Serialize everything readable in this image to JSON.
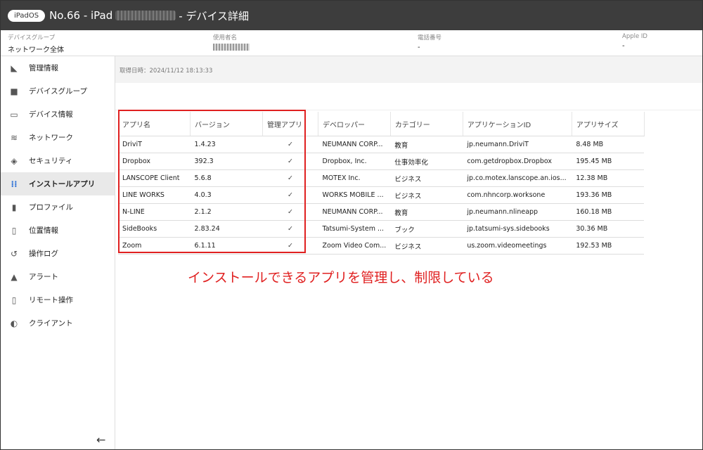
{
  "header": {
    "os_badge": "iPadOS",
    "title_prefix": "No.66 - iPad",
    "title_suffix": "- デバイス詳細"
  },
  "info": {
    "device_group_label": "デバイスグループ",
    "device_group_value": "ネットワーク全体",
    "user_label": "使用者名",
    "phone_label": "電話番号",
    "phone_value": "-",
    "apple_id_label": "Apple ID",
    "apple_id_value": "-"
  },
  "sidebar": {
    "items": [
      {
        "label": "管理情報",
        "icon": "tag-icon"
      },
      {
        "label": "デバイスグループ",
        "icon": "folder-icon"
      },
      {
        "label": "デバイス情報",
        "icon": "devices-icon"
      },
      {
        "label": "ネットワーク",
        "icon": "wifi-icon"
      },
      {
        "label": "セキュリティ",
        "icon": "shield-icon"
      },
      {
        "label": "インストールアプリ",
        "icon": "apps-grid-icon"
      },
      {
        "label": "プロファイル",
        "icon": "file-icon"
      },
      {
        "label": "位置情報",
        "icon": "map-icon"
      },
      {
        "label": "操作ログ",
        "icon": "history-icon"
      },
      {
        "label": "アラート",
        "icon": "warning-icon"
      },
      {
        "label": "リモート操作",
        "icon": "remote-phone-icon"
      },
      {
        "label": "クライアント",
        "icon": "toggle-icon"
      }
    ],
    "active_index": 5
  },
  "main": {
    "fetched_at": "取得日時：2024/11/12 18:13:33"
  },
  "table": {
    "headers": [
      "アプリ名",
      "バージョン",
      "管理アプリ",
      "デベロッパー",
      "カテゴリー",
      "アプリケーションID",
      "アプリサイズ"
    ],
    "rows": [
      [
        "DriviT",
        "1.4.23",
        "✓",
        "NEUMANN CORP...",
        "教育",
        "jp.neumann.DriviT",
        "8.48 MB"
      ],
      [
        "Dropbox",
        "392.3",
        "✓",
        "Dropbox, Inc.",
        "仕事効率化",
        "com.getdropbox.Dropbox",
        "195.45 MB"
      ],
      [
        "LANSCOPE Client",
        "5.6.8",
        "✓",
        "MOTEX Inc.",
        "ビジネス",
        "jp.co.motex.lanscope.an.ios...",
        "12.38 MB"
      ],
      [
        "LINE WORKS",
        "4.0.3",
        "✓",
        "WORKS MOBILE ...",
        "ビジネス",
        "com.nhncorp.worksone",
        "193.36 MB"
      ],
      [
        "N-LINE",
        "2.1.2",
        "✓",
        "NEUMANN CORP...",
        "教育",
        "jp.neumann.nlineapp",
        "160.18 MB"
      ],
      [
        "SideBooks",
        "2.83.24",
        "✓",
        "Tatsumi-System ...",
        "ブック",
        "jp.tatsumi-sys.sidebooks",
        "30.36 MB"
      ],
      [
        "Zoom",
        "6.1.11",
        "✓",
        "Zoom Video Com...",
        "ビジネス",
        "us.zoom.videomeetings",
        "192.53 MB"
      ]
    ]
  },
  "annotation": "インストールできるアプリを管理し、制限している",
  "colors": {
    "header_bg": "#3d3d3d",
    "highlight_red": "#e02020",
    "active_nav_bg": "#e9e9e9"
  }
}
